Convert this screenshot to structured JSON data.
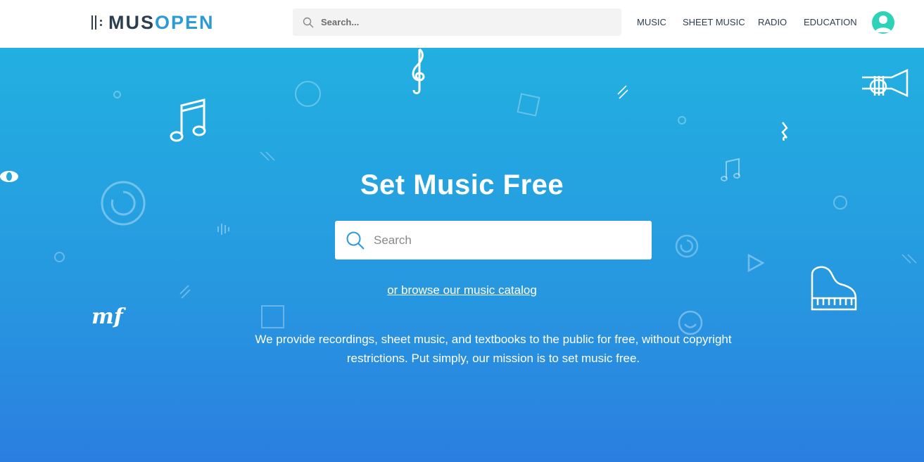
{
  "header": {
    "logo": {
      "part1": "MUS",
      "part2": "OPEN"
    },
    "search": {
      "placeholder": "Search..."
    },
    "nav": [
      {
        "label": "MUSIC"
      },
      {
        "label": "SHEET MUSIC"
      },
      {
        "label": "RADIO"
      },
      {
        "label": "EDUCATION"
      }
    ],
    "avatar_icon": "user-avatar-icon"
  },
  "hero": {
    "title": "Set Music Free",
    "search": {
      "placeholder": "Search"
    },
    "browse_link": "or browse our music catalog",
    "mission": "We provide recordings, sheet music, and textbooks to the public for free, without copyright restrictions. Put simply, our mission is to set music free.",
    "decorations": [
      "music-notes-icon",
      "treble-clef-icon",
      "trumpet-icon",
      "piano-icon",
      "mezzo-forte-icon",
      "eighth-rest-icon",
      "whole-note-icon",
      "play-icon",
      "smile-icon",
      "loop-icon",
      "soundwave-icon"
    ]
  },
  "colors": {
    "brand_dark": "#2c3e50",
    "brand_blue": "#2a9bd8",
    "hero_top": "#22b0e0",
    "hero_bottom": "#2b7ee0",
    "avatar": "#2ed3b7"
  }
}
